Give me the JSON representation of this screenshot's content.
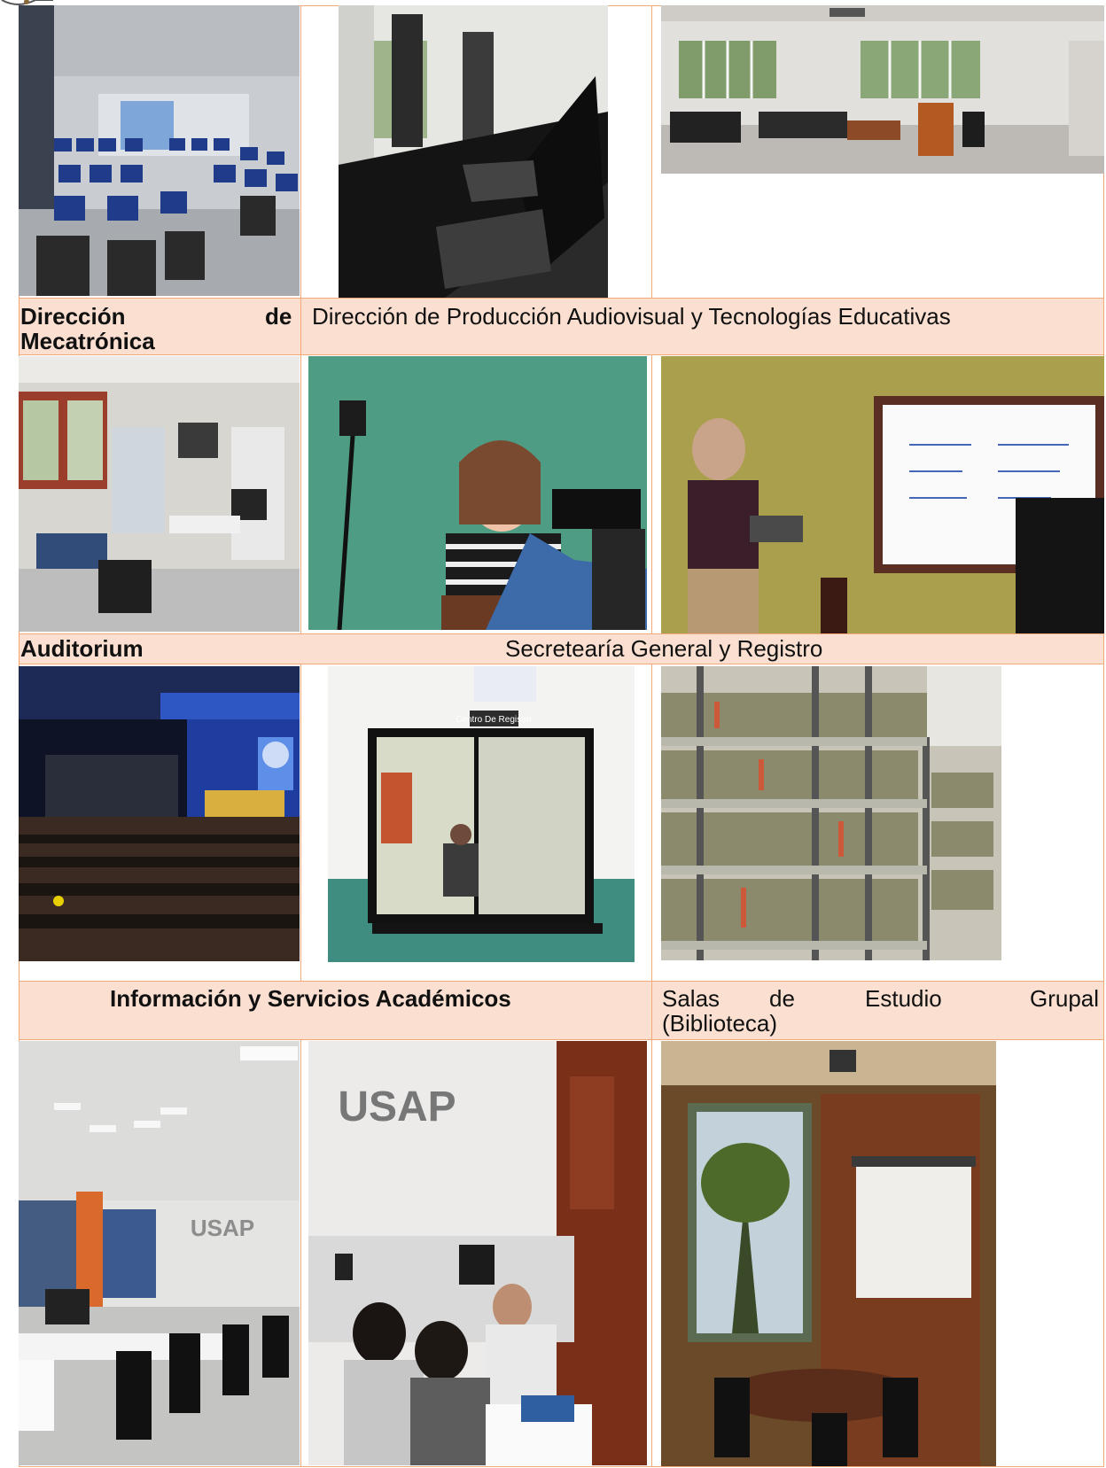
{
  "labels": {
    "mecatronica_line1": "Dirección",
    "mecatronica_de": "de",
    "mecatronica_line2": "Mecatrónica",
    "audiovisual": "Dirección de Producción Audiovisual y Tecnologías Educativas",
    "auditorium": "Auditorium",
    "secretaria": "Secretearía General y  Registro",
    "informacion": "Información y Servicios  Académicos",
    "salas_word1": "Salas",
    "salas_word2": "de",
    "salas_word3": "Estudio",
    "salas_word4": "Grupal",
    "salas_line2": "(Biblioteca)"
  },
  "photo_signage": {
    "usap_logo_text": "USAP",
    "registro_sign": "Centro De Registro"
  },
  "colors": {
    "border": "#f2a979",
    "label_band": "#fbe0d1"
  }
}
